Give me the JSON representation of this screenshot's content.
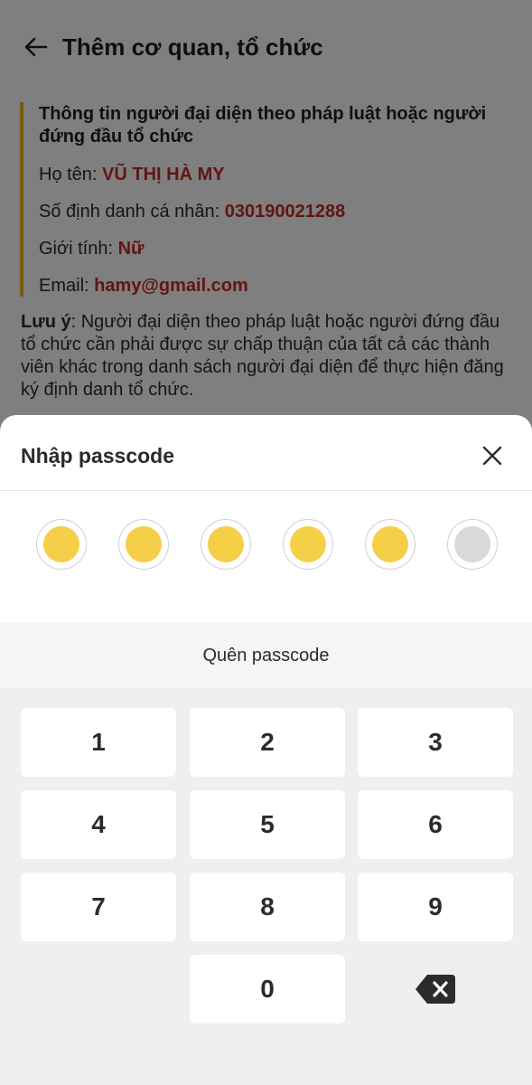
{
  "header": {
    "title": "Thêm cơ quan, tổ chức"
  },
  "info": {
    "heading": "Thông tin người đại diện theo pháp luật hoặc người đứng đầu tổ chức",
    "name_label": "Họ tên:",
    "name_value": "VŨ THỊ HÀ MY",
    "id_label": "Số định danh cá nhân:",
    "id_value": "030190021288",
    "gender_label": "Giới tính:",
    "gender_value": "Nữ",
    "email_label": "Email:",
    "email_value": "hamy@gmail.com"
  },
  "note": {
    "label": "Lưu ý",
    "text": ": Người đại diện theo pháp luật hoặc người đứng đầu tổ chức cần phải được sự chấp thuận của tất cả các thành viên khác trong danh sách người đại diện để thực hiện đăng ký định danh tổ chức."
  },
  "sheet": {
    "title": "Nhập passcode",
    "forgot_label": "Quên passcode",
    "passcode_length": 6,
    "entered_digits": 5
  },
  "keypad": {
    "keys": [
      "1",
      "2",
      "3",
      "4",
      "5",
      "6",
      "7",
      "8",
      "9",
      "0"
    ]
  },
  "colors": {
    "accent": "#f5cf47",
    "value_red": "#c62828",
    "bar_yellow": "#e8b928",
    "empty_dot": "#d9d9d9"
  },
  "icons": {
    "back": "arrow-left-icon",
    "close": "close-icon",
    "delete": "backspace-icon"
  }
}
